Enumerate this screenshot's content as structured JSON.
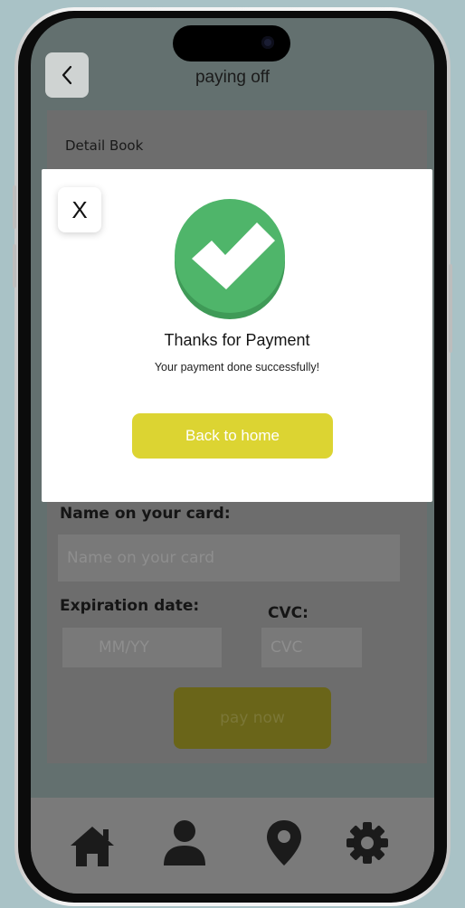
{
  "header": {
    "title": "paying off"
  },
  "detail": {
    "title": "Detail Book"
  },
  "form": {
    "name_label": "Name on your card:",
    "name_placeholder": "Name on your card",
    "expiry_label": "Expiration date:",
    "expiry_placeholder": "MM/YY",
    "cvc_label": "CVC:",
    "cvc_placeholder": "CVC",
    "pay_label": "pay now"
  },
  "modal": {
    "close_label": "X",
    "title": "Thanks for Payment",
    "subtitle": "Your payment done successfully!",
    "button_label": "Back to home",
    "success_icon": "check-circle-icon",
    "success_color": "#4fb56a"
  },
  "nav": {
    "items": [
      {
        "icon": "home-icon"
      },
      {
        "icon": "user-icon"
      },
      {
        "icon": "location-pin-icon"
      },
      {
        "icon": "gear-icon"
      }
    ]
  },
  "colors": {
    "accent": "#dcd432",
    "overlay_screen": "#63706f",
    "modal_bg": "#ffffff"
  }
}
